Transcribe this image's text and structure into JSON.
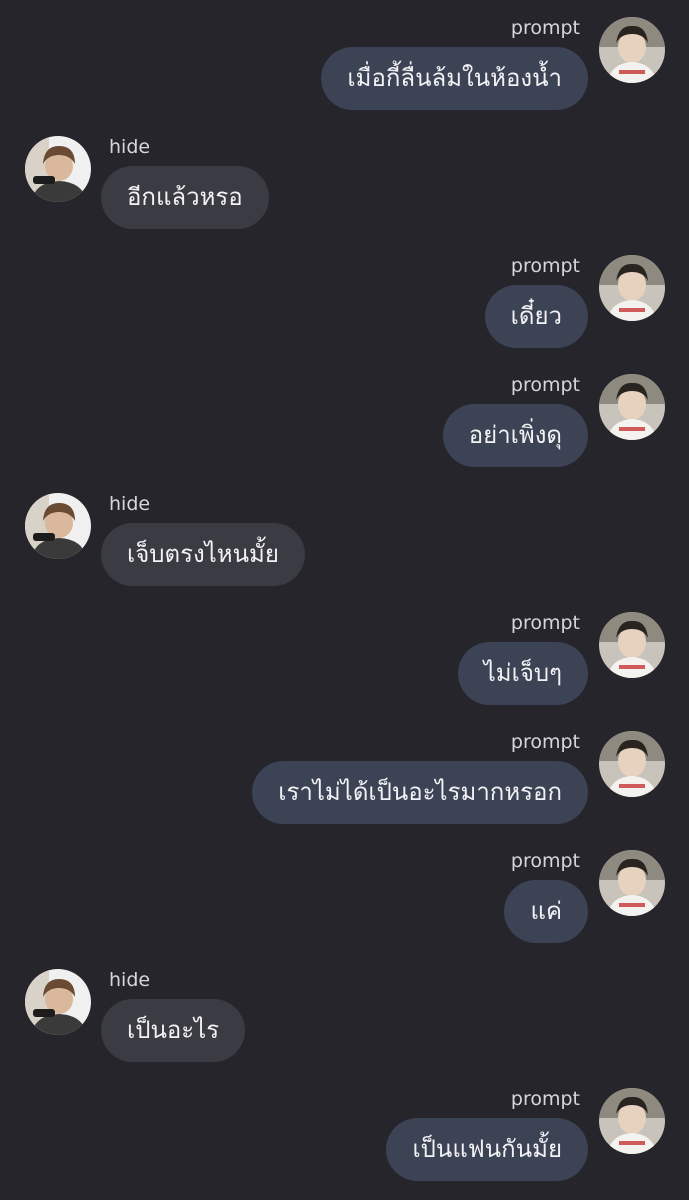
{
  "colors": {
    "background": "#25252b",
    "bubble_self": "#3c4355",
    "bubble_other": "#3b3b43",
    "text": "#f2f2f5",
    "name": "#d6d6db"
  },
  "messages": [
    {
      "sender": "prompt",
      "text": "เมื่อกี้ลื่นล้มในห้องน้ำ",
      "side": "right",
      "avatar_icon": "prompt-avatar-icon"
    },
    {
      "sender": "hide",
      "text": "อีกแล้วหรอ",
      "side": "left",
      "avatar_icon": "hide-avatar-icon"
    },
    {
      "sender": "prompt",
      "text": "เดี๋ยว",
      "side": "right",
      "avatar_icon": "prompt-avatar-icon"
    },
    {
      "sender": "prompt",
      "text": "อย่าเพิ่งดุ",
      "side": "right",
      "avatar_icon": "prompt-avatar-icon"
    },
    {
      "sender": "hide",
      "text": "เจ็บตรงไหนมั้ย",
      "side": "left",
      "avatar_icon": "hide-avatar-icon"
    },
    {
      "sender": "prompt",
      "text": "ไม่เจ็บๆ",
      "side": "right",
      "avatar_icon": "prompt-avatar-icon"
    },
    {
      "sender": "prompt",
      "text": "เราไม่ได้เป็นอะไรมากหรอก",
      "side": "right",
      "avatar_icon": "prompt-avatar-icon"
    },
    {
      "sender": "prompt",
      "text": "แค่",
      "side": "right",
      "avatar_icon": "prompt-avatar-icon"
    },
    {
      "sender": "hide",
      "text": "เป็นอะไร",
      "side": "left",
      "avatar_icon": "hide-avatar-icon"
    },
    {
      "sender": "prompt",
      "text": "เป็นแฟนกันมั้ย",
      "side": "right",
      "avatar_icon": "prompt-avatar-icon"
    }
  ]
}
